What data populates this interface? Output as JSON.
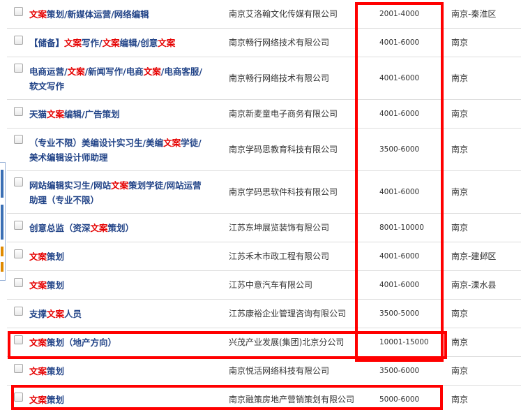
{
  "rows": [
    {
      "title": [
        {
          "t": "文案",
          "hl": true
        },
        {
          "t": "策划/新媒体运营/网络编辑",
          "hl": false
        }
      ],
      "company": "南京艾洛翰文化传媒有限公司",
      "salary": "2001-4000",
      "city": "南京-秦淮区"
    },
    {
      "title": [
        {
          "t": "【储备】",
          "hl": false
        },
        {
          "t": "文案",
          "hl": true
        },
        {
          "t": "写作/",
          "hl": false
        },
        {
          "t": "文案",
          "hl": true
        },
        {
          "t": "编辑/创意",
          "hl": false
        },
        {
          "t": "文案",
          "hl": true
        }
      ],
      "company": "南京畅行网络技术有限公司",
      "salary": "4001-6000",
      "city": "南京"
    },
    {
      "title": [
        {
          "t": "电商运营/",
          "hl": false
        },
        {
          "t": "文案",
          "hl": true
        },
        {
          "t": "/新闻写作/电商",
          "hl": false
        },
        {
          "t": "文案",
          "hl": true
        },
        {
          "t": "/电商客服/软文写作",
          "hl": false
        }
      ],
      "company": "南京畅行网络技术有限公司",
      "salary": "4001-6000",
      "city": "南京"
    },
    {
      "title": [
        {
          "t": "天猫",
          "hl": false
        },
        {
          "t": "文案",
          "hl": true
        },
        {
          "t": "编辑/广告策划",
          "hl": false
        }
      ],
      "company": "南京新麦童电子商务有限公司",
      "salary": "4001-6000",
      "city": "南京"
    },
    {
      "title": [
        {
          "t": "（专业不限）美编设计实习生/美编",
          "hl": false
        },
        {
          "t": "文案",
          "hl": true
        },
        {
          "t": "学徒/美术编辑设计师助理",
          "hl": false
        }
      ],
      "company": "南京学码思教育科技有限公司",
      "salary": "3500-6000",
      "city": "南京"
    },
    {
      "title": [
        {
          "t": "网站编辑实习生/网站",
          "hl": false
        },
        {
          "t": "文案",
          "hl": true
        },
        {
          "t": "策划学徒/网站运营助理（专业不限）",
          "hl": false
        }
      ],
      "company": "南京学码思软件科技有限公司",
      "salary": "4001-6000",
      "city": "南京"
    },
    {
      "title": [
        {
          "t": "创意总监（资深",
          "hl": false
        },
        {
          "t": "文案",
          "hl": true
        },
        {
          "t": "策划）",
          "hl": false
        }
      ],
      "company": "江苏东坤展览装饰有限公司",
      "salary": "8001-10000",
      "city": "南京"
    },
    {
      "title": [
        {
          "t": "文案",
          "hl": true
        },
        {
          "t": "策划",
          "hl": false
        }
      ],
      "company": "江苏禾木市政工程有限公司",
      "salary": "4001-6000",
      "city": "南京-建邺区"
    },
    {
      "title": [
        {
          "t": "文案",
          "hl": true
        },
        {
          "t": "策划",
          "hl": false
        }
      ],
      "company": "江苏中意汽车有限公司",
      "salary": "4001-6000",
      "city": "南京-溧水县"
    },
    {
      "title": [
        {
          "t": "支撑",
          "hl": false
        },
        {
          "t": "文案",
          "hl": true
        },
        {
          "t": "人员",
          "hl": false
        }
      ],
      "company": "江苏康裕企业管理咨询有限公司",
      "salary": "3500-5000",
      "city": "南京"
    },
    {
      "title": [
        {
          "t": "文案",
          "hl": true
        },
        {
          "t": "策划（地产方向）",
          "hl": false
        }
      ],
      "company": "兴茂产业发展(集团)北京分公司",
      "salary": "10001-15000",
      "city": "南京"
    },
    {
      "title": [
        {
          "t": "文案",
          "hl": true
        },
        {
          "t": "策划",
          "hl": false
        }
      ],
      "company": "南京悦活网络科技有限公司",
      "salary": "3500-6000",
      "city": "南京"
    },
    {
      "title": [
        {
          "t": "文案",
          "hl": true
        },
        {
          "t": "策划",
          "hl": false
        }
      ],
      "company": "南京融策房地产营销策划有限公司",
      "salary": "5000-6000",
      "city": "南京"
    }
  ],
  "colors": {
    "title_link": "#224488",
    "keyword_highlight": "#e50000",
    "annotation_box": "#ff0000",
    "row_divider": "#dddddd"
  }
}
